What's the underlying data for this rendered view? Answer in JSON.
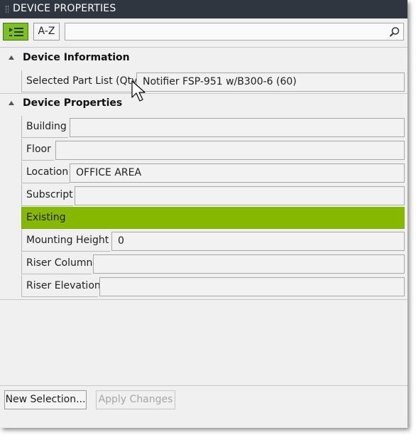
{
  "panel": {
    "title": "DEVICE PROPERTIES"
  },
  "toolbar": {
    "categorized_icon": "categorized-list-icon",
    "az_label": "A-Z",
    "search_value": "",
    "search_icon": "search-icon"
  },
  "categories": [
    {
      "label": "Device Information",
      "properties": [
        {
          "label": "Selected Part List (Qty)",
          "value": "Notifier FSP-951 w/B300-6 (60)"
        }
      ]
    },
    {
      "label": "Device Properties",
      "properties": [
        {
          "label": "Building",
          "value": ""
        },
        {
          "label": "Floor",
          "value": ""
        },
        {
          "label": "Location",
          "value": "OFFICE AREA"
        },
        {
          "label": "Subscript",
          "value": ""
        },
        {
          "label": "Existing",
          "value": "",
          "highlight_color": "#87b800"
        },
        {
          "label": "Mounting Height",
          "value": "0"
        },
        {
          "label": "Riser Column",
          "value": ""
        },
        {
          "label": "Riser Elevation",
          "value": ""
        }
      ]
    }
  ],
  "footer": {
    "new_selection_label": "New Selection...",
    "apply_changes_label": "Apply Changes"
  },
  "colors": {
    "title_bg": "#2f3640",
    "accent_green": "#7fbf25",
    "highlight_green": "#87b800"
  }
}
